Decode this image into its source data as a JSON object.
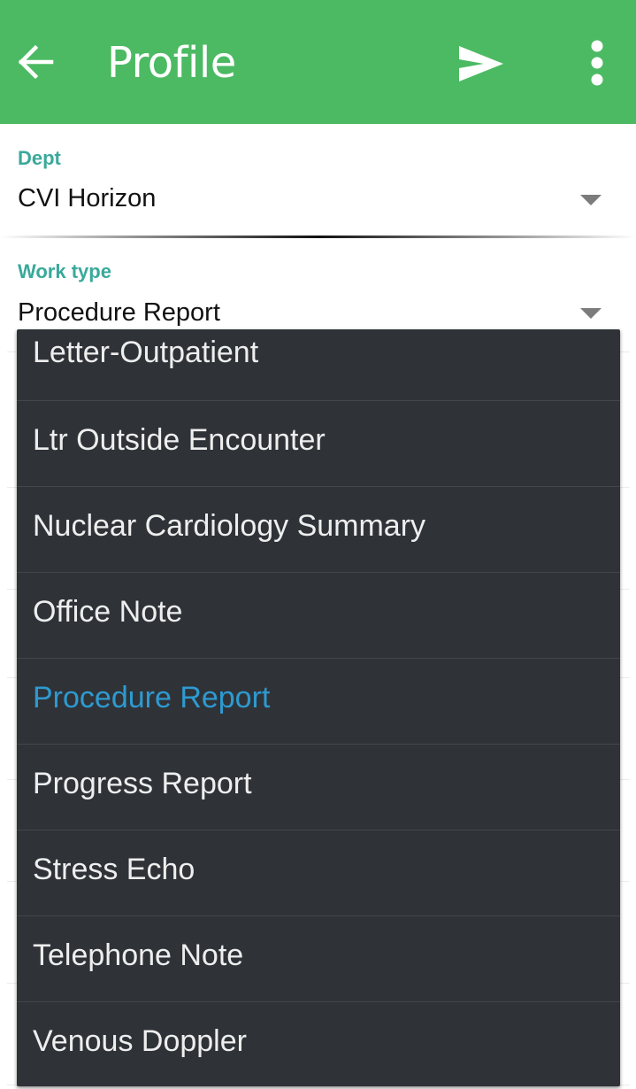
{
  "appbar": {
    "title": "Profile",
    "back_icon": "arrow-back-icon",
    "send_icon": "send-icon",
    "more_icon": "more-vert-icon",
    "background_color": "#4cba63"
  },
  "form": {
    "dept": {
      "label": "Dept",
      "value": "CVI Horizon"
    },
    "work_type": {
      "label": "Work type",
      "value": "Procedure Report"
    },
    "label_color": "#3aa99a"
  },
  "dropdown": {
    "items": [
      {
        "label": "Letter-Outpatient",
        "selected": false
      },
      {
        "label": "Ltr Outside Encounter",
        "selected": false
      },
      {
        "label": "Nuclear Cardiology Summary",
        "selected": false
      },
      {
        "label": "Office Note",
        "selected": false
      },
      {
        "label": "Procedure Report",
        "selected": true
      },
      {
        "label": "Progress Report",
        "selected": false
      },
      {
        "label": "Stress Echo",
        "selected": false
      },
      {
        "label": "Telephone Note",
        "selected": false
      },
      {
        "label": "Venous Doppler",
        "selected": false
      }
    ],
    "background_color": "#2f3338",
    "selected_color": "#2e9ad0"
  }
}
